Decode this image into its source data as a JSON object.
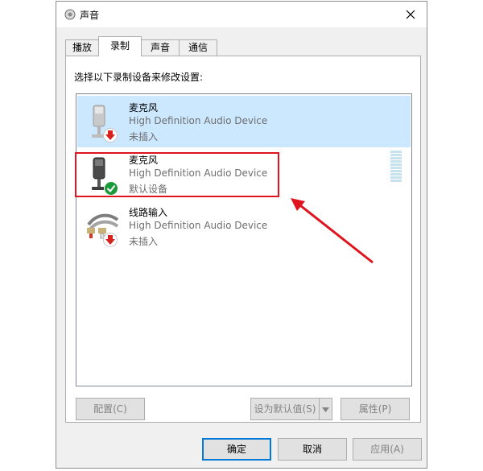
{
  "window": {
    "title": "声音",
    "title_icon": "speaker-icon",
    "close_icon": "close-icon"
  },
  "tabs": [
    {
      "label": "播放"
    },
    {
      "label": "录制"
    },
    {
      "label": "声音"
    },
    {
      "label": "通信"
    }
  ],
  "active_tab": "录制",
  "instruction": "选择以下录制设备来修改设置:",
  "devices": [
    {
      "name": "麦克风",
      "description": "High Definition Audio Device",
      "status": "未插入",
      "icon": "microphone-icon",
      "badge": "unplugged-arrow-icon",
      "selected": true
    },
    {
      "name": "麦克风",
      "description": "High Definition Audio Device",
      "status": "默认设备",
      "icon": "microphone-icon",
      "badge": "default-check-icon",
      "selected": false
    },
    {
      "name": "线路输入",
      "description": "High Definition Audio Device",
      "status": "未插入",
      "icon": "line-in-cable-icon",
      "badge": "unplugged-arrow-icon",
      "selected": false
    }
  ],
  "buttons": {
    "configure": "配置(C)",
    "set_default": "设为默认值(S)",
    "properties": "属性(P)",
    "ok": "确定",
    "cancel": "取消",
    "apply": "应用(A)"
  },
  "colors": {
    "selection": "#cce8ff",
    "annotation": "#e0141e",
    "default_button_border": "#0078d7"
  }
}
